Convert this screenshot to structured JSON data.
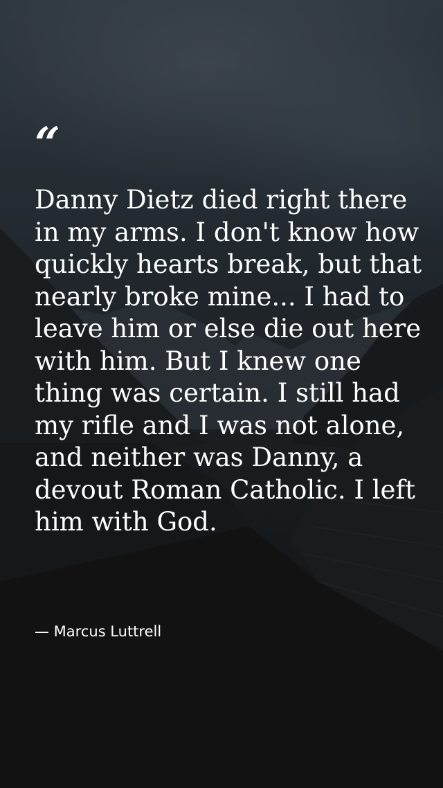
{
  "quote": {
    "mark": "“",
    "text": "Danny Dietz died right there in my arms. I don't know how quickly hearts break, but that nearly broke mine... I had to leave him or else die out here with him. But I knew one thing was certain. I still had my rifle and I was not alone, and neither was Danny, a devout Roman Catholic. I left him with God.",
    "author": "— Marcus Luttrell"
  },
  "colors": {
    "text": "#ffffff",
    "sky": "#2e373f",
    "ground": "#151617"
  }
}
